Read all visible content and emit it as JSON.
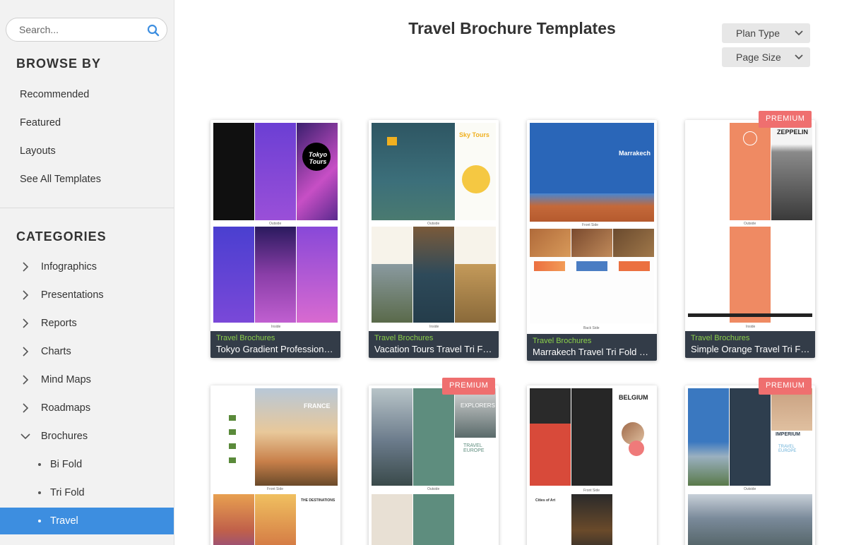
{
  "search": {
    "placeholder": "Search..."
  },
  "browse": {
    "heading": "BROWSE BY",
    "items": [
      "Recommended",
      "Featured",
      "Layouts",
      "See All Templates"
    ]
  },
  "categories": {
    "heading": "CATEGORIES",
    "items": [
      "Infographics",
      "Presentations",
      "Reports",
      "Charts",
      "Mind Maps",
      "Roadmaps",
      "Brochures"
    ],
    "subitems": [
      "Bi Fold",
      "Tri Fold",
      "Travel"
    ]
  },
  "page": {
    "title": "Travel Brochure Templates",
    "filters": [
      "Plan Type",
      "Page Size"
    ]
  },
  "premium_label": "PREMIUM",
  "cards": [
    {
      "category": "Travel Brochures",
      "name": "Tokyo Gradient Professional Travel Tri Fold Brochure",
      "t1": "Tokyo Tours",
      "t2": "Outside",
      "t3": "Inside"
    },
    {
      "category": "Travel Brochures",
      "name": "Vacation Tours Travel Tri Fold Brochure",
      "t1": "Sky Tours",
      "t2": "Outside",
      "t3": "Inside"
    },
    {
      "category": "Travel Brochures",
      "name": "Marrakech Travel Tri Fold Brochure",
      "t1": "Marrakech",
      "t2": "Front Side",
      "t3": "Back Side"
    },
    {
      "category": "Travel Brochures",
      "name": "Simple Orange Travel Tri Fold Brochure",
      "t1": "ZEPPELIN",
      "t2": "Outside",
      "t3": "Inside"
    },
    {
      "t1": "FRANCE",
      "t2": "Front Side",
      "t3": "THE DESTINATIONS"
    },
    {
      "t1": "EXPLORERS",
      "t2": "Outside",
      "t3": "TRAVEL EUROPE"
    },
    {
      "t1": "BELGIUM",
      "t2": "Front Side",
      "t3": "Cities of Art"
    },
    {
      "t1": "IMPERIUM",
      "t2": "Outside",
      "t3": "TRAVEL EUROPE"
    }
  ],
  "colors": {
    "accent": "#3d8ee0",
    "premium": "#ef6f6f",
    "caption_bg": "#333c48",
    "caption_category": "#8bd04a"
  }
}
